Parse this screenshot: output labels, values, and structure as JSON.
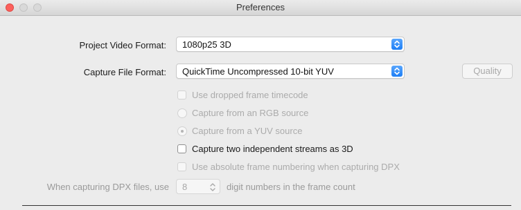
{
  "window": {
    "title": "Preferences"
  },
  "project_video_format": {
    "label": "Project Video Format:",
    "value": "1080p25 3D"
  },
  "capture_file_format": {
    "label": "Capture File Format:",
    "value": "QuickTime Uncompressed 10-bit YUV",
    "quality_button": "Quality"
  },
  "options": {
    "use_dropped_frame_timecode": {
      "label": "Use dropped frame timecode",
      "checked": false,
      "enabled": false
    },
    "capture_from_rgb": {
      "label": "Capture from an RGB source",
      "selected": false,
      "enabled": false
    },
    "capture_from_yuv": {
      "label": "Capture from a YUV source",
      "selected": true,
      "enabled": false
    },
    "capture_two_streams_3d": {
      "label": "Capture two independent streams as 3D",
      "checked": false,
      "enabled": true
    },
    "absolute_frame_numbering": {
      "label": "Use absolute frame numbering when capturing DPX",
      "checked": false,
      "enabled": false
    }
  },
  "dpx": {
    "prefix": "When capturing DPX files, use",
    "digits": "8",
    "suffix": "digit numbers in the frame count"
  },
  "colors": {
    "accent_blue": "#1d7ef5",
    "close_red": "#fc605c",
    "background": "#ececec"
  },
  "icons": {
    "select_stepper": "up-down-chevron-icon",
    "window_close": "close-icon"
  }
}
